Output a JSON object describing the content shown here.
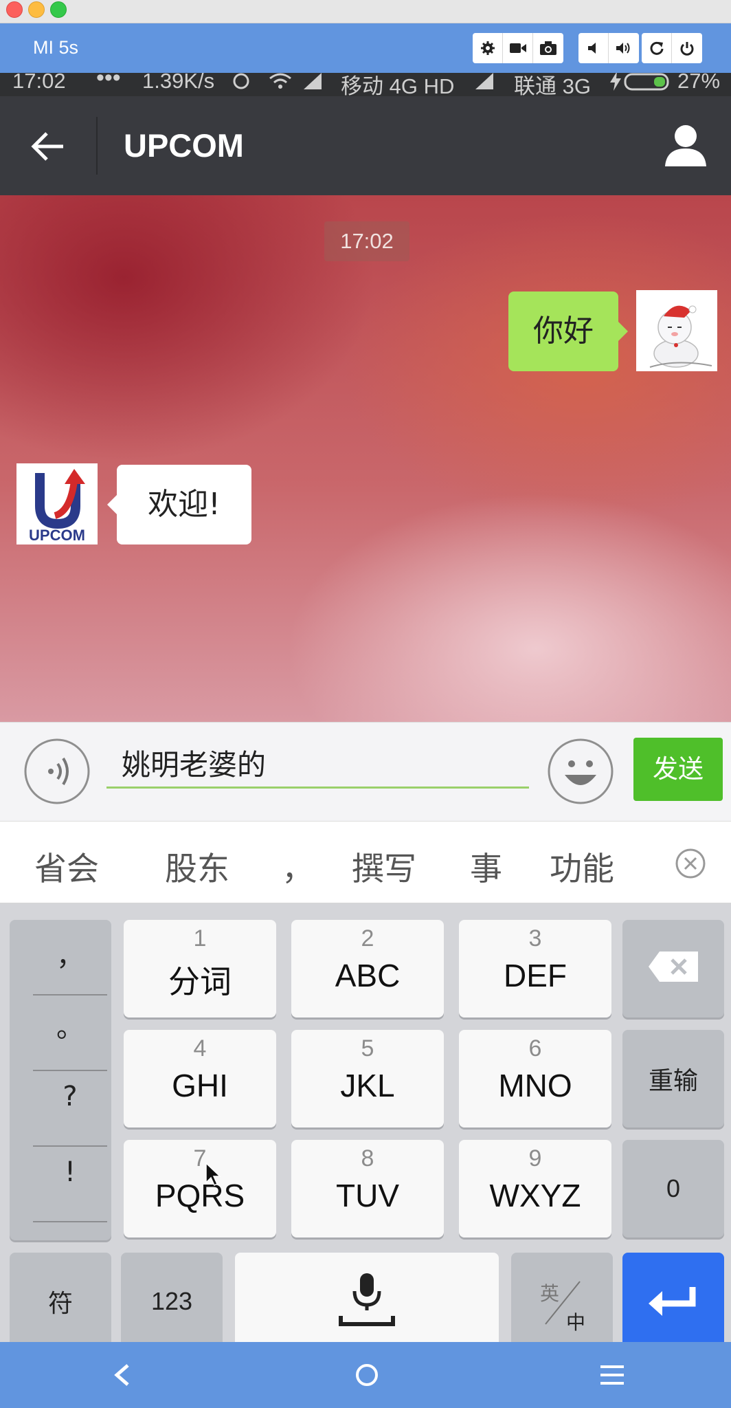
{
  "window": {
    "device_name": "MI 5s",
    "toolbar_icons": [
      "gear-icon",
      "video-camera-icon",
      "camera-icon",
      "volume-down-icon",
      "volume-up-icon",
      "rotate-icon",
      "power-icon"
    ]
  },
  "status_bar": {
    "time": "17:02",
    "dots": "•••",
    "speed": "1.39K/s",
    "carrier1": "移动 4G HD",
    "carrier2": "联通 3G",
    "battery": "27%"
  },
  "app_bar": {
    "title": "UPCOM"
  },
  "chat": {
    "timestamp": "17:02",
    "messages": [
      {
        "side": "right",
        "text": "你好"
      },
      {
        "side": "left",
        "text": "欢迎!",
        "avatar_text": "UPCOM"
      }
    ]
  },
  "input": {
    "value": "姚明老婆的",
    "send_label": "发送"
  },
  "candidates": [
    "省会",
    "股东",
    "，",
    "撰写",
    "事",
    "功能"
  ],
  "keyboard": {
    "punctuation": [
      "，",
      "。",
      "?",
      "!"
    ],
    "keys": [
      {
        "num": "1",
        "label": "分词"
      },
      {
        "num": "2",
        "label": "ABC"
      },
      {
        "num": "3",
        "label": "DEF"
      },
      {
        "num": "4",
        "label": "GHI"
      },
      {
        "num": "5",
        "label": "JKL"
      },
      {
        "num": "6",
        "label": "MNO"
      },
      {
        "num": "7",
        "label": "PQRS"
      },
      {
        "num": "8",
        "label": "TUV"
      },
      {
        "num": "9",
        "label": "WXYZ"
      }
    ],
    "reenter_label": "重输",
    "zero_label": "0",
    "symbol_label": "符",
    "numeric_label": "123",
    "lang_top": "英",
    "lang_bottom": "中"
  }
}
